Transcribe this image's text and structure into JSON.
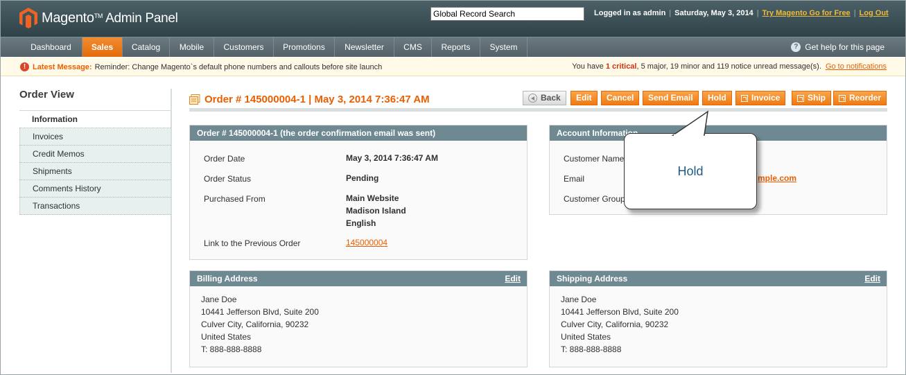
{
  "header": {
    "logo_text": "Magento",
    "logo_suffix": "Admin Panel",
    "search_value": "Global Record Search",
    "logged_in": "Logged in as admin",
    "date": "Saturday, May 3, 2014",
    "try_link": "Try Magento Go for Free",
    "logout_link": "Log Out"
  },
  "nav": {
    "items": [
      "Dashboard",
      "Sales",
      "Catalog",
      "Mobile",
      "Customers",
      "Promotions",
      "Newsletter",
      "CMS",
      "Reports",
      "System"
    ],
    "active": "Sales",
    "help": "Get help for this page"
  },
  "message": {
    "label": "Latest Message:",
    "text": "Reminder: Change Magento`s default phone numbers and callouts before site launch",
    "summary_prefix": "You have",
    "critical_count": "1",
    "critical_label": "critical",
    "summary_rest": ", 5 major, 19 minor and 119 notice unread message(s).",
    "notifications_link": "Go to notifications"
  },
  "sidebar": {
    "title": "Order View",
    "items": [
      "Information",
      "Invoices",
      "Credit Memos",
      "Shipments",
      "Comments History",
      "Transactions"
    ]
  },
  "page": {
    "title": "Order # 145000004-1 | May 3, 2014 7:36:47 AM",
    "buttons": [
      "Back",
      "Edit",
      "Cancel",
      "Send Email",
      "Hold",
      "Invoice",
      "Ship",
      "Reorder"
    ]
  },
  "order_box": {
    "header": "Order # 145000004-1 (the order confirmation email was sent)",
    "date_label": "Order Date",
    "date_value": "May 3, 2014 7:36:47 AM",
    "status_label": "Order Status",
    "status_value": "Pending",
    "purchased_label": "Purchased From",
    "purchased_lines": [
      "Main Website",
      "Madison Island",
      "English"
    ],
    "prev_label": "Link to the Previous Order",
    "prev_value": "145000004"
  },
  "account_box": {
    "header": "Account Information",
    "name_label": "Customer Name",
    "email_label": "Email",
    "email_value": "mple.com",
    "group_label": "Customer Group"
  },
  "billing": {
    "header": "Billing Address",
    "edit": "Edit",
    "lines": [
      "Jane Doe",
      "10441 Jefferson Blvd, Suite 200",
      "Culver City, California, 90232",
      "United States",
      "T: 888-888-8888"
    ]
  },
  "shipping": {
    "header": "Shipping Address",
    "edit": "Edit",
    "lines": [
      "Jane Doe",
      "10441 Jefferson Blvd, Suite 200",
      "Culver City, California, 90232",
      "United States",
      "T: 888-888-8888"
    ]
  },
  "callout": {
    "text": "Hold"
  },
  "colors": {
    "accent": "#eb5e00",
    "header": "#3c5158",
    "box_header": "#6f8992"
  }
}
